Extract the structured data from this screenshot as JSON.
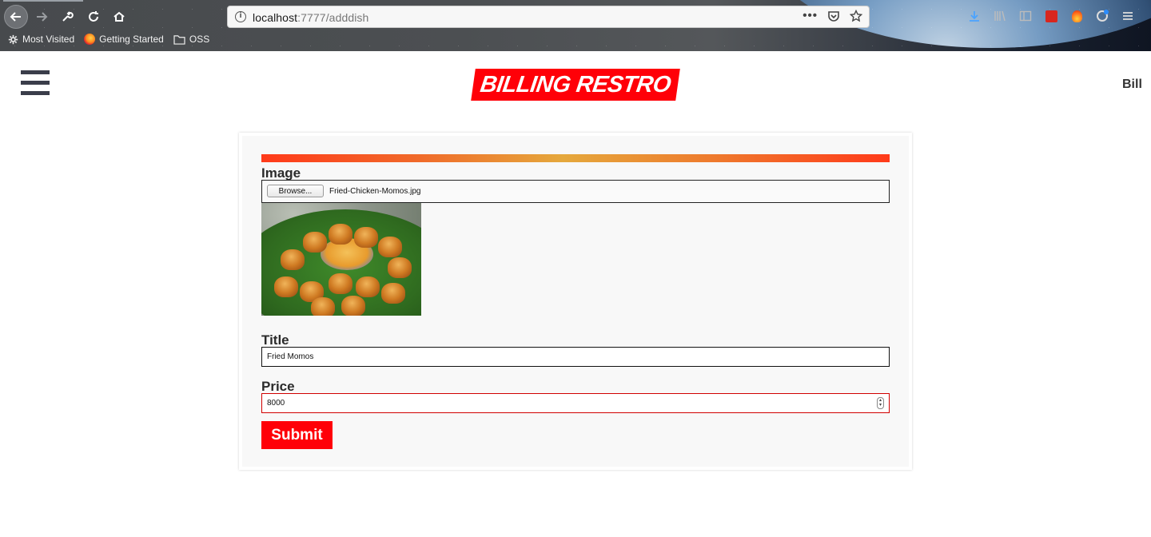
{
  "browser": {
    "url_host": "localhost",
    "url_path": ":7777/adddish",
    "bookmarks": [
      {
        "label": "Most Visited",
        "icon": "gear-icon"
      },
      {
        "label": "Getting Started",
        "icon": "firefox-icon"
      },
      {
        "label": "OSS",
        "icon": "folder-icon"
      }
    ],
    "url_tools": [
      "more-icon",
      "pocket-icon",
      "star-icon"
    ]
  },
  "header": {
    "logo_text": "BILLING RESTRO",
    "bill_link": "Bill"
  },
  "form": {
    "image_label": "Image",
    "browse_label": "Browse...",
    "file_name": "Fried-Chicken-Momos.jpg",
    "title_label": "Title",
    "title_value": "Fried Momos",
    "price_label": "Price",
    "price_value": "8000",
    "submit_label": "Submit"
  },
  "colors": {
    "brand_red": "#ff0008",
    "gradient": [
      "#ff3a1a",
      "#e5a83c",
      "#ff3a1a"
    ]
  }
}
